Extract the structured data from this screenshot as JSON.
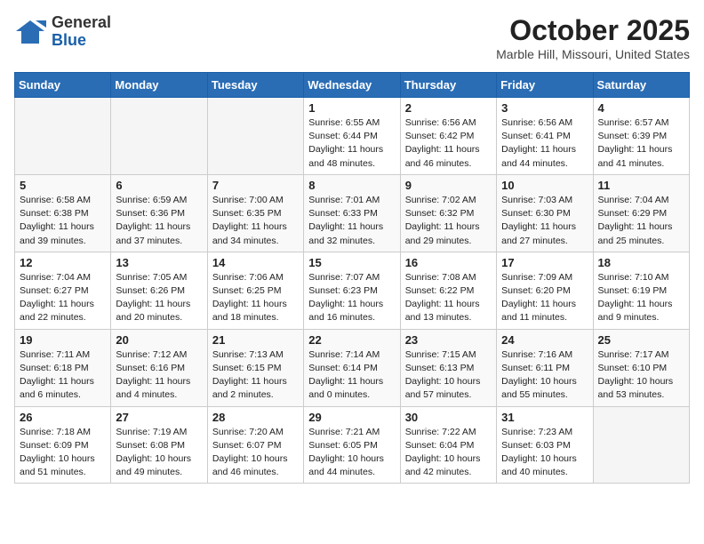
{
  "header": {
    "logo_general": "General",
    "logo_blue": "Blue",
    "month": "October 2025",
    "location": "Marble Hill, Missouri, United States"
  },
  "weekdays": [
    "Sunday",
    "Monday",
    "Tuesday",
    "Wednesday",
    "Thursday",
    "Friday",
    "Saturday"
  ],
  "weeks": [
    [
      {
        "day": "",
        "info": ""
      },
      {
        "day": "",
        "info": ""
      },
      {
        "day": "",
        "info": ""
      },
      {
        "day": "1",
        "info": "Sunrise: 6:55 AM\nSunset: 6:44 PM\nDaylight: 11 hours\nand 48 minutes."
      },
      {
        "day": "2",
        "info": "Sunrise: 6:56 AM\nSunset: 6:42 PM\nDaylight: 11 hours\nand 46 minutes."
      },
      {
        "day": "3",
        "info": "Sunrise: 6:56 AM\nSunset: 6:41 PM\nDaylight: 11 hours\nand 44 minutes."
      },
      {
        "day": "4",
        "info": "Sunrise: 6:57 AM\nSunset: 6:39 PM\nDaylight: 11 hours\nand 41 minutes."
      }
    ],
    [
      {
        "day": "5",
        "info": "Sunrise: 6:58 AM\nSunset: 6:38 PM\nDaylight: 11 hours\nand 39 minutes."
      },
      {
        "day": "6",
        "info": "Sunrise: 6:59 AM\nSunset: 6:36 PM\nDaylight: 11 hours\nand 37 minutes."
      },
      {
        "day": "7",
        "info": "Sunrise: 7:00 AM\nSunset: 6:35 PM\nDaylight: 11 hours\nand 34 minutes."
      },
      {
        "day": "8",
        "info": "Sunrise: 7:01 AM\nSunset: 6:33 PM\nDaylight: 11 hours\nand 32 minutes."
      },
      {
        "day": "9",
        "info": "Sunrise: 7:02 AM\nSunset: 6:32 PM\nDaylight: 11 hours\nand 29 minutes."
      },
      {
        "day": "10",
        "info": "Sunrise: 7:03 AM\nSunset: 6:30 PM\nDaylight: 11 hours\nand 27 minutes."
      },
      {
        "day": "11",
        "info": "Sunrise: 7:04 AM\nSunset: 6:29 PM\nDaylight: 11 hours\nand 25 minutes."
      }
    ],
    [
      {
        "day": "12",
        "info": "Sunrise: 7:04 AM\nSunset: 6:27 PM\nDaylight: 11 hours\nand 22 minutes."
      },
      {
        "day": "13",
        "info": "Sunrise: 7:05 AM\nSunset: 6:26 PM\nDaylight: 11 hours\nand 20 minutes."
      },
      {
        "day": "14",
        "info": "Sunrise: 7:06 AM\nSunset: 6:25 PM\nDaylight: 11 hours\nand 18 minutes."
      },
      {
        "day": "15",
        "info": "Sunrise: 7:07 AM\nSunset: 6:23 PM\nDaylight: 11 hours\nand 16 minutes."
      },
      {
        "day": "16",
        "info": "Sunrise: 7:08 AM\nSunset: 6:22 PM\nDaylight: 11 hours\nand 13 minutes."
      },
      {
        "day": "17",
        "info": "Sunrise: 7:09 AM\nSunset: 6:20 PM\nDaylight: 11 hours\nand 11 minutes."
      },
      {
        "day": "18",
        "info": "Sunrise: 7:10 AM\nSunset: 6:19 PM\nDaylight: 11 hours\nand 9 minutes."
      }
    ],
    [
      {
        "day": "19",
        "info": "Sunrise: 7:11 AM\nSunset: 6:18 PM\nDaylight: 11 hours\nand 6 minutes."
      },
      {
        "day": "20",
        "info": "Sunrise: 7:12 AM\nSunset: 6:16 PM\nDaylight: 11 hours\nand 4 minutes."
      },
      {
        "day": "21",
        "info": "Sunrise: 7:13 AM\nSunset: 6:15 PM\nDaylight: 11 hours\nand 2 minutes."
      },
      {
        "day": "22",
        "info": "Sunrise: 7:14 AM\nSunset: 6:14 PM\nDaylight: 11 hours\nand 0 minutes."
      },
      {
        "day": "23",
        "info": "Sunrise: 7:15 AM\nSunset: 6:13 PM\nDaylight: 10 hours\nand 57 minutes."
      },
      {
        "day": "24",
        "info": "Sunrise: 7:16 AM\nSunset: 6:11 PM\nDaylight: 10 hours\nand 55 minutes."
      },
      {
        "day": "25",
        "info": "Sunrise: 7:17 AM\nSunset: 6:10 PM\nDaylight: 10 hours\nand 53 minutes."
      }
    ],
    [
      {
        "day": "26",
        "info": "Sunrise: 7:18 AM\nSunset: 6:09 PM\nDaylight: 10 hours\nand 51 minutes."
      },
      {
        "day": "27",
        "info": "Sunrise: 7:19 AM\nSunset: 6:08 PM\nDaylight: 10 hours\nand 49 minutes."
      },
      {
        "day": "28",
        "info": "Sunrise: 7:20 AM\nSunset: 6:07 PM\nDaylight: 10 hours\nand 46 minutes."
      },
      {
        "day": "29",
        "info": "Sunrise: 7:21 AM\nSunset: 6:05 PM\nDaylight: 10 hours\nand 44 minutes."
      },
      {
        "day": "30",
        "info": "Sunrise: 7:22 AM\nSunset: 6:04 PM\nDaylight: 10 hours\nand 42 minutes."
      },
      {
        "day": "31",
        "info": "Sunrise: 7:23 AM\nSunset: 6:03 PM\nDaylight: 10 hours\nand 40 minutes."
      },
      {
        "day": "",
        "info": ""
      }
    ]
  ]
}
